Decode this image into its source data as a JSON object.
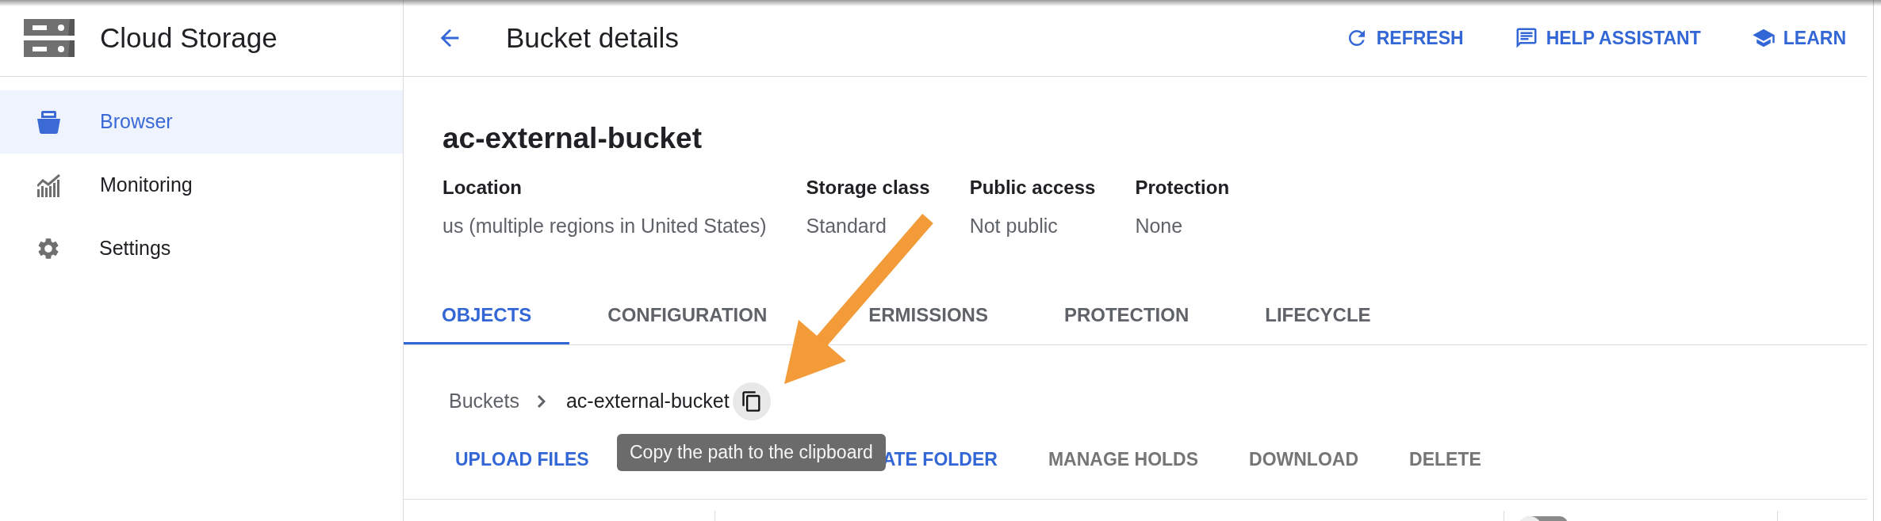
{
  "app": {
    "title": "Cloud Storage"
  },
  "sidebar": {
    "items": [
      {
        "label": "Browser",
        "selected": true
      },
      {
        "label": "Monitoring",
        "selected": false
      },
      {
        "label": "Settings",
        "selected": false
      }
    ]
  },
  "header": {
    "title": "Bucket details",
    "actions": [
      "REFRESH",
      "HELP ASSISTANT",
      "LEARN"
    ]
  },
  "bucket": {
    "name": "ac-external-bucket",
    "properties": [
      {
        "label": "Location",
        "value": "us (multiple regions in United States)"
      },
      {
        "label": "Storage class",
        "value": "Standard"
      },
      {
        "label": "Public access",
        "value": "Not public"
      },
      {
        "label": "Protection",
        "value": "None"
      }
    ]
  },
  "tabs": [
    {
      "label": "OBJECTS",
      "selected": true
    },
    {
      "label": "CONFIGURATION",
      "selected": false
    },
    {
      "label": "ERMISSIONS",
      "selected": false
    },
    {
      "label": "PROTECTION",
      "selected": false
    },
    {
      "label": "LIFECYCLE",
      "selected": false
    }
  ],
  "breadcrumb": {
    "items": [
      "Buckets",
      "ac-external-bucket"
    ]
  },
  "tooltip": {
    "text": "Copy the path to the clipboard"
  },
  "actions": [
    {
      "label": "UPLOAD FILES",
      "disabled": false
    },
    {
      "label": "ATE FOLDER",
      "disabled": false
    },
    {
      "label": "MANAGE HOLDS",
      "disabled": true
    },
    {
      "label": "DOWNLOAD",
      "disabled": true
    },
    {
      "label": "DELETE",
      "disabled": true
    }
  ],
  "table": {
    "switch": {
      "on": false
    }
  }
}
